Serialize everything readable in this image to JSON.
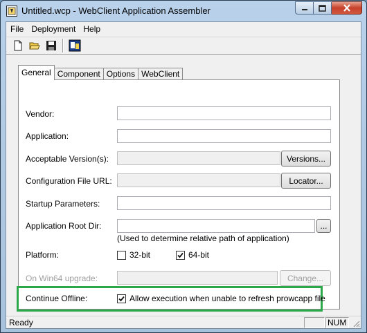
{
  "window": {
    "title": "Untitled.wcp - WebClient Application Assembler"
  },
  "menu": {
    "items": [
      "File",
      "Deployment",
      "Help"
    ]
  },
  "toolbar": {
    "icons": [
      "new-document-icon",
      "open-folder-icon",
      "save-disk-icon",
      "deploy-icon"
    ]
  },
  "tabs": [
    "General",
    "Component",
    "Options",
    "WebClient"
  ],
  "active_tab": "General",
  "form": {
    "vendor": {
      "label": "Vendor:",
      "value": ""
    },
    "application": {
      "label": "Application:",
      "value": ""
    },
    "acceptable_versions": {
      "label": "Acceptable Version(s):",
      "value": "",
      "button": "Versions..."
    },
    "config_url": {
      "label": "Configuration File URL:",
      "value": "",
      "button": "Locator..."
    },
    "startup_params": {
      "label": "Startup Parameters:",
      "value": ""
    },
    "app_root_dir": {
      "label": "Application Root Dir:",
      "value": "",
      "button": "...",
      "hint": "(Used to determine relative path of application)"
    },
    "platform": {
      "label": "Platform:",
      "opt_32": {
        "label": "32-bit",
        "checked": false
      },
      "opt_64": {
        "label": "64-bit",
        "checked": true
      }
    },
    "win64_upgrade": {
      "label": "On Win64 upgrade:",
      "value": "",
      "button": "Change..."
    },
    "continue_offline": {
      "label": "Continue Offline:",
      "checkbox_label": "Allow execution when unable to refresh prowcapp file",
      "checked": true
    }
  },
  "status": {
    "text": "Ready",
    "num": "NUM"
  },
  "colors": {
    "highlight": "#2ba84a",
    "title_bg": "#b9d1ea",
    "close_btn": "#c7412b"
  }
}
